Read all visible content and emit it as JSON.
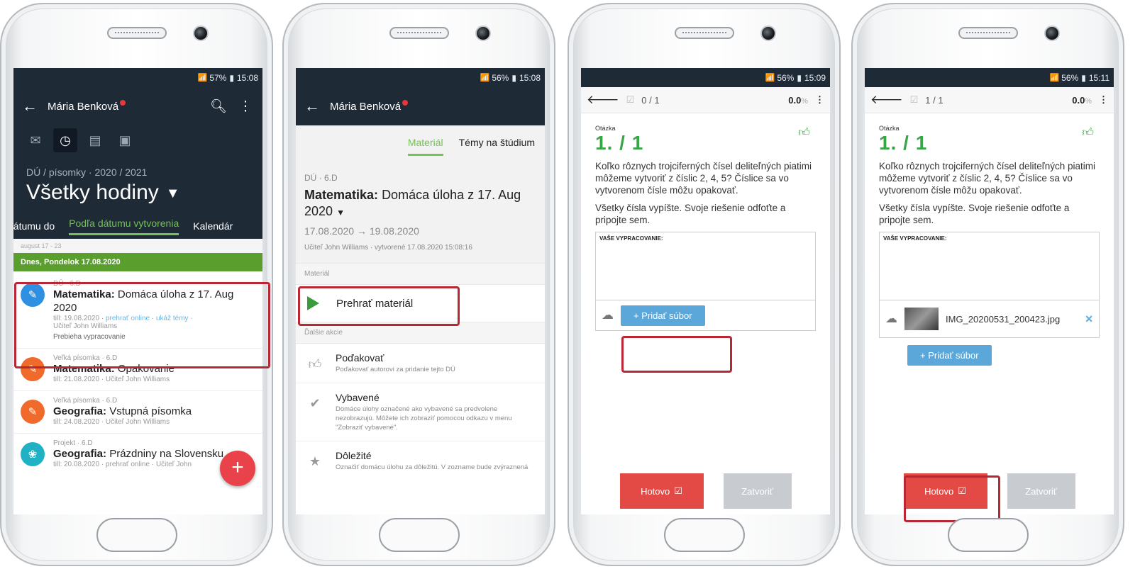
{
  "phone1": {
    "status": "57%",
    "time": "15:08",
    "user": "Mária Benková",
    "filter_sub": "DÚ / písomky · 2020 / 2021",
    "filter_title": "Všetky hodiny",
    "tabs": [
      "dátumu do",
      "Podľa dátumu vytvorenia",
      "Kalendár"
    ],
    "week": "august 17 - 23",
    "day": "Dnes, Pondelok 17.08.2020",
    "items": [
      {
        "meta": "DÚ · 6.D",
        "subject": "Matematika:",
        "title": "Domáca úloha z 17. Aug 2020",
        "till": "till: 19.08.2020",
        "link1": "prehrať online",
        "link2": "ukáž témy",
        "teacher": "Učiteľ John Williams",
        "state": "Prebieha vypracovanie",
        "color": "#2f8fe0",
        "icon": "✎"
      },
      {
        "meta": "Veľká písomka · 6.D",
        "subject": "Matematika:",
        "title": "Opakovanie",
        "till": "till: 21.08.2020 · Učiteľ John Williams",
        "color": "#ef6a2b",
        "icon": "✎"
      },
      {
        "meta": "Veľká písomka · 6.D",
        "subject": "Geografia:",
        "title": "Vstupná písomka",
        "till": "till: 24.08.2020 · Učiteľ John Williams",
        "color": "#ef6a2b",
        "icon": "✎"
      },
      {
        "meta": "Projekt · 6.D",
        "subject": "Geografia:",
        "title": "Prázdniny na Slovensku",
        "till": "till: 20.08.2020 · prehrať online · Učiteľ John",
        "color": "#20b2c4",
        "icon": "❀"
      }
    ]
  },
  "phone2": {
    "status": "56%",
    "time": "15:08",
    "user": "Mária Benková",
    "tabs": [
      "Materiál",
      "Témy na štúdium"
    ],
    "meta": "DÚ · 6.D",
    "subject": "Matematika:",
    "title": "Domáca úloha z 17. Aug 2020",
    "dates": "17.08.2020 → 19.08.2020",
    "by": "Učiteľ John Williams · vytvorené 17.08.2020 15:08:16",
    "section_material": "Materiál",
    "play": "Prehrať materiál",
    "section_more": "Ďalšie akcie",
    "actions": [
      {
        "title": "Poďakovať",
        "desc": "Poďakovať autorovi za pridanie tejto DÚ",
        "icon": "👍"
      },
      {
        "title": "Vybavené",
        "desc": "Domáce úlohy označené ako vybavené sa predvolene nezobrazujú. Môžete ich zobraziť pomocou odkazu v menu \"Zobraziť vybavené\".",
        "icon": "✔"
      },
      {
        "title": "Dôležité",
        "desc": "Označiť domácu úlohu za dôležitú. V zozname bude zvýraznená",
        "icon": "★"
      }
    ]
  },
  "phone3": {
    "status": "56%",
    "time": "15:09",
    "counter": "0 / 1",
    "percent": "0.0",
    "label": "Otázka",
    "number": "1. / 1",
    "q1": "Koľko rôznych trojciferných čísel deliteľných piatimi môžeme vytvoriť z číslic 2, 4, 5? Číslice sa vo vytvorenom čísle môžu opakovať.",
    "q2": "Všetky čísla vypíšte. Svoje riešenie odfoťte a pripojte sem.",
    "answer_header": "VAŠE VYPRACOVANIE:",
    "add_file": "+ Pridať súbor",
    "done": "Hotovo",
    "close": "Zatvoriť"
  },
  "phone4": {
    "status": "56%",
    "time": "15:11",
    "counter": "1 / 1",
    "percent": "0.0",
    "label": "Otázka",
    "number": "1. / 1",
    "q1": "Koľko rôznych trojciferných čísel deliteľných piatimi môžeme vytvoriť z číslic 2, 4, 5? Číslice sa vo vytvorenom čísle môžu opakovať.",
    "q2": "Všetky čísla vypíšte. Svoje riešenie odfoťte a pripojte sem.",
    "answer_header": "VAŠE VYPRACOVANIE:",
    "file_name": "IMG_20200531_200423.jpg",
    "add_file": "+ Pridať súbor",
    "done": "Hotovo",
    "close": "Zatvoriť"
  }
}
